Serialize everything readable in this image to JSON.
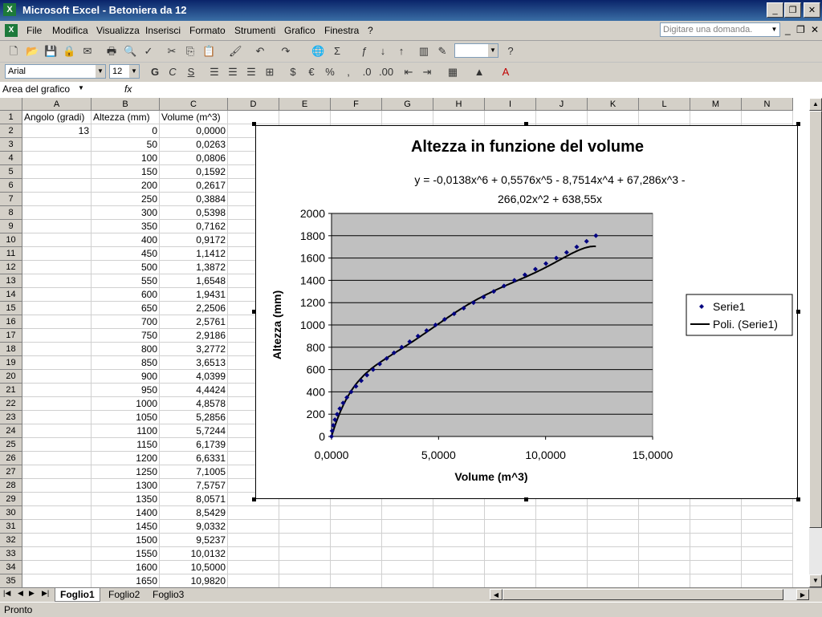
{
  "window": {
    "title": "Microsoft Excel - Betoniera da 12",
    "app_icon": "excel-icon"
  },
  "menu": {
    "items": [
      "File",
      "Modifica",
      "Visualizza",
      "Inserisci",
      "Formato",
      "Strumenti",
      "Grafico",
      "Finestra",
      "?"
    ],
    "question_placeholder": "Digitare una domanda."
  },
  "formatting": {
    "font": "Arial",
    "size": "12"
  },
  "namebox": {
    "value": "Area del grafico",
    "fx": "fx"
  },
  "grid": {
    "columns": [
      "A",
      "B",
      "C",
      "D",
      "E",
      "F",
      "G",
      "H",
      "I",
      "J",
      "K",
      "L",
      "M",
      "N"
    ],
    "header_row": [
      "Angolo (gradi)",
      "Altezza (mm)",
      "Volume (m^3)"
    ],
    "angle_value": "13",
    "rows": [
      [
        "2",
        "0",
        "0,0000"
      ],
      [
        "3",
        "50",
        "0,0263"
      ],
      [
        "4",
        "100",
        "0,0806"
      ],
      [
        "5",
        "150",
        "0,1592"
      ],
      [
        "6",
        "200",
        "0,2617"
      ],
      [
        "7",
        "250",
        "0,3884"
      ],
      [
        "8",
        "300",
        "0,5398"
      ],
      [
        "9",
        "350",
        "0,7162"
      ],
      [
        "10",
        "400",
        "0,9172"
      ],
      [
        "11",
        "450",
        "1,1412"
      ],
      [
        "12",
        "500",
        "1,3872"
      ],
      [
        "13",
        "550",
        "1,6548"
      ],
      [
        "14",
        "600",
        "1,9431"
      ],
      [
        "15",
        "650",
        "2,2506"
      ],
      [
        "16",
        "700",
        "2,5761"
      ],
      [
        "17",
        "750",
        "2,9186"
      ],
      [
        "18",
        "800",
        "3,2772"
      ],
      [
        "19",
        "850",
        "3,6513"
      ],
      [
        "20",
        "900",
        "4,0399"
      ],
      [
        "21",
        "950",
        "4,4424"
      ],
      [
        "22",
        "1000",
        "4,8578"
      ],
      [
        "23",
        "1050",
        "5,2856"
      ],
      [
        "24",
        "1100",
        "5,7244"
      ],
      [
        "25",
        "1150",
        "6,1739"
      ],
      [
        "26",
        "1200",
        "6,6331"
      ],
      [
        "27",
        "1250",
        "7,1005"
      ],
      [
        "28",
        "1300",
        "7,5757"
      ],
      [
        "29",
        "1350",
        "8,0571"
      ],
      [
        "30",
        "1400",
        "8,5429"
      ],
      [
        "31",
        "1450",
        "9,0332"
      ],
      [
        "32",
        "1500",
        "9,5237"
      ],
      [
        "33",
        "1550",
        "10,0132"
      ],
      [
        "34",
        "1600",
        "10,5000"
      ],
      [
        "35",
        "1650",
        "10,9820"
      ]
    ]
  },
  "sheets": {
    "tabs": [
      "Foglio1",
      "Foglio2",
      "Foglio3"
    ],
    "active": "Foglio1"
  },
  "status": {
    "text": "Pronto"
  },
  "chart_data": {
    "type": "scatter",
    "title": "Altezza in funzione del volume",
    "xlabel": "Volume (m^3)",
    "ylabel": "Altezza (mm)",
    "xlim": [
      0,
      15
    ],
    "ylim": [
      0,
      2000
    ],
    "x_ticks": [
      "0,0000",
      "5,0000",
      "10,0000",
      "15,0000"
    ],
    "y_ticks": [
      "0",
      "200",
      "400",
      "600",
      "800",
      "1000",
      "1200",
      "1400",
      "1600",
      "1800",
      "2000"
    ],
    "grid": true,
    "legend_position": "right",
    "plot_background": "#c0c0c0",
    "marker_color": "#000080",
    "trendline_label_line1": "y = -0,0138x^6 + 0,5576x^5 - 8,7514x^4 + 67,286x^3 -",
    "trendline_label_line2": "266,02x^2 + 638,55x",
    "trend_coefficients": [
      0,
      638.55,
      -266.02,
      67.286,
      -8.7514,
      0.5576,
      -0.0138
    ],
    "legend": [
      "Serie1",
      "Poli. (Serie1)"
    ],
    "series": [
      {
        "name": "Serie1",
        "x": [
          0,
          0.0263,
          0.0806,
          0.1592,
          0.2617,
          0.3884,
          0.5398,
          0.7162,
          0.9172,
          1.1412,
          1.3872,
          1.6548,
          1.9431,
          2.2506,
          2.5761,
          2.9186,
          3.2772,
          3.6513,
          4.0399,
          4.4424,
          4.8578,
          5.2856,
          5.7244,
          6.1739,
          6.6331,
          7.1005,
          7.5757,
          8.0571,
          8.5429,
          9.0332,
          9.5237,
          10.0132,
          10.5,
          10.982,
          11.455,
          11.915,
          12.35
        ],
        "y": [
          0,
          50,
          100,
          150,
          200,
          250,
          300,
          350,
          400,
          450,
          500,
          550,
          600,
          650,
          700,
          750,
          800,
          850,
          900,
          950,
          1000,
          1050,
          1100,
          1150,
          1200,
          1250,
          1300,
          1350,
          1400,
          1450,
          1500,
          1550,
          1600,
          1650,
          1700,
          1750,
          1800
        ]
      }
    ]
  }
}
